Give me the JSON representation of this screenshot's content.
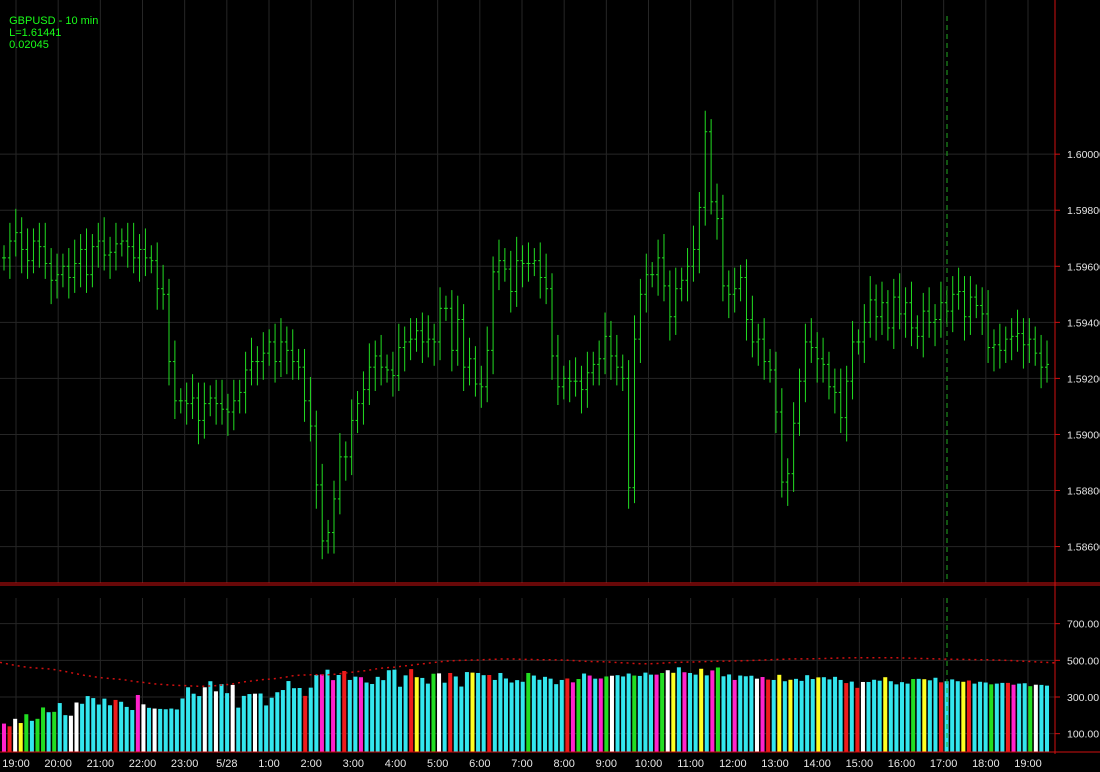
{
  "header": {
    "symbol_interval": "GBPUSD - 10 min",
    "last": "L=1.61441",
    "change": "0.02045"
  },
  "colors": {
    "background": "#000000",
    "grid": "#262626",
    "price_bars": "#22dd22",
    "axis_border": "#d01010",
    "axis_text": "#e6e6e6",
    "volume_up": "#33e6ee",
    "volume_strong": "#ffffff",
    "volume_down": "#ee1c1c",
    "volume_green": "#22dd22",
    "volume_yellow": "#ffff22",
    "volume_magenta": "#ff22cc",
    "volume_average": "#d01010",
    "cursor": "#22aa22"
  },
  "chart_data": [
    {
      "type": "ohlc",
      "title": "GBPUSD - 10 min",
      "y_axis_position": "right",
      "ylim": [
        1.5847,
        1.6055
      ],
      "yticks": [
        "1.60000",
        "1.59800",
        "1.59600",
        "1.59400",
        "1.59200",
        "1.59000",
        "1.58800",
        "1.58600"
      ],
      "ytick_values": [
        1.6,
        1.598,
        1.596,
        1.594,
        1.592,
        1.59,
        1.588,
        1.586
      ],
      "x_session_labels": [
        "19:00",
        "20:00",
        "21:00",
        "22:00",
        "23:00",
        "5/28",
        "1:00",
        "2:00",
        "3:00",
        "4:00",
        "5:00",
        "6:00",
        "7:00",
        "8:00",
        "9:00",
        "10:00",
        "11:00",
        "12:00",
        "13:00",
        "14:00",
        "15:00",
        "16:00",
        "17:00",
        "18:00",
        "19:00"
      ],
      "grid": true,
      "bar_interval": "10 min",
      "closes": [
        1.5963,
        1.5969,
        1.5972,
        1.5966,
        1.5962,
        1.5969,
        1.5967,
        1.5961,
        1.5955,
        1.5957,
        1.596,
        1.5956,
        1.5961,
        1.5966,
        1.5957,
        1.5967,
        1.5969,
        1.5964,
        1.5965,
        1.5968,
        1.5969,
        1.5967,
        1.5963,
        1.5966,
        1.5963,
        1.5962,
        1.5952,
        1.595,
        1.5926,
        1.5912,
        1.5912,
        1.5911,
        1.5913,
        1.5905,
        1.5911,
        1.5913,
        1.5911,
        1.5909,
        1.5908,
        1.5912,
        1.5915,
        1.5923,
        1.5926,
        1.5926,
        1.5929,
        1.5933,
        1.5926,
        1.5933,
        1.593,
        1.5926,
        1.5924,
        1.5912,
        1.5903,
        1.5882,
        1.5862,
        1.5865,
        1.5877,
        1.5892,
        1.5892,
        1.5905,
        1.5911,
        1.5916,
        1.5924,
        1.5928,
        1.5924,
        1.5923,
        1.5921,
        1.5931,
        1.5933,
        1.5934,
        1.5937,
        1.5933,
        1.5934,
        1.5933,
        1.5945,
        1.5945,
        1.593,
        1.5941,
        1.5924,
        1.5927,
        1.5918,
        1.5917,
        1.593,
        1.5958,
        1.5962,
        1.5959,
        1.5951,
        1.5962,
        1.5961,
        1.5961,
        1.5962,
        1.5956,
        1.5952,
        1.5928,
        1.5917,
        1.592,
        1.5919,
        1.5919,
        1.5916,
        1.5922,
        1.5925,
        1.5927,
        1.5935,
        1.5928,
        1.5924,
        1.592,
        1.5881,
        1.5934,
        1.595,
        1.5957,
        1.5957,
        1.5963,
        1.5953,
        1.5942,
        1.5952,
        1.5955,
        1.596,
        1.5966,
        1.5981,
        1.6008,
        1.5983,
        1.5977,
        1.5953,
        1.595,
        1.5952,
        1.5956,
        1.5941,
        1.5933,
        1.5934,
        1.5926,
        1.5923,
        1.5908,
        1.5883,
        1.5886,
        1.5904,
        1.5919,
        1.5933,
        1.5931,
        1.5927,
        1.5925,
        1.5917,
        1.5915,
        1.5906,
        1.5919,
        1.5933,
        1.5933,
        1.594,
        1.5948,
        1.5942,
        1.5947,
        1.5938,
        1.5949,
        1.5943,
        1.5947,
        1.5938,
        1.5935,
        1.5944,
        1.594,
        1.5941,
        1.5947,
        1.5944,
        1.595,
        1.5951,
        1.5942,
        1.5949,
        1.5946,
        1.5943,
        1.5931,
        1.5932,
        1.593,
        1.5934,
        1.5935,
        1.5936,
        1.5932,
        1.5934,
        1.5929,
        1.5924,
        1.5925
      ]
    },
    {
      "type": "bar",
      "title": "Volume",
      "y_axis_position": "right",
      "ylim": [
        0,
        840
      ],
      "yticks": [
        "700.00",
        "500.00",
        "300.00",
        "100.00"
      ],
      "ytick_values": [
        700,
        500,
        300,
        100
      ],
      "grid": true,
      "average_line": "dotted, red",
      "values": [
        155,
        140,
        181,
        158,
        206,
        170,
        181,
        243,
        217,
        219,
        267,
        201,
        198,
        270,
        263,
        305,
        294,
        259,
        291,
        255,
        284,
        274,
        246,
        229,
        311,
        260,
        241,
        237,
        235,
        233,
        237,
        232,
        292,
        353,
        318,
        305,
        353,
        386,
        331,
        370,
        321,
        366,
        242,
        306,
        316,
        318,
        319,
        254,
        296,
        326,
        338,
        387,
        348,
        349,
        306,
        351,
        420,
        423,
        449,
        392,
        420,
        442,
        393,
        411,
        408,
        379,
        371,
        410,
        392,
        446,
        449,
        356,
        418,
        452,
        408,
        404,
        373,
        427,
        429,
        378,
        431,
        412,
        357,
        436,
        433,
        431,
        419,
        420,
        393,
        431,
        401,
        379,
        392,
        383,
        431,
        417,
        394,
        410,
        400,
        370,
        393,
        401,
        380,
        398,
        428,
        417,
        400,
        401,
        412,
        416,
        419,
        412,
        428,
        417,
        415,
        433,
        422,
        422,
        431,
        446,
        432,
        462,
        435,
        431,
        422,
        454,
        418,
        445,
        461,
        413,
        423,
        393,
        417,
        413,
        416,
        400,
        409,
        395,
        393,
        421,
        386,
        394,
        399,
        388,
        419,
        398,
        407,
        408,
        396,
        410,
        393,
        376,
        384,
        350,
        382,
        382,
        394,
        389,
        408,
        386,
        369,
        381,
        373,
        398,
        399,
        397,
        391,
        405,
        380,
        386,
        396,
        386,
        383,
        390,
        373,
        383,
        379,
        369,
        373,
        377,
        377,
        367,
        373,
        375,
        359,
        367,
        366,
        362
      ],
      "average": [
        489,
        483,
        476,
        471,
        466,
        462,
        459,
        457,
        455,
        452,
        448,
        442,
        437,
        430,
        424,
        418,
        414,
        409,
        405,
        402,
        400,
        397,
        394,
        389,
        384,
        381,
        377,
        373,
        370,
        368,
        366,
        364,
        363,
        362,
        360,
        359,
        359,
        360,
        361,
        364,
        367,
        370,
        376,
        381,
        385,
        389,
        393,
        396,
        398,
        401,
        406,
        410,
        416,
        419,
        420,
        421,
        421,
        420,
        421,
        423,
        426,
        430,
        434,
        437,
        441,
        444,
        450,
        455,
        458,
        461,
        463,
        467,
        470,
        474,
        478,
        481,
        485,
        489,
        492,
        496,
        497,
        499,
        500,
        502,
        502,
        502,
        504,
        505,
        506,
        507,
        507,
        507,
        506,
        505,
        505,
        504,
        503,
        503,
        503,
        502,
        502,
        500,
        498,
        496,
        494,
        493,
        493,
        492,
        491,
        489,
        487,
        486,
        484,
        482,
        481,
        481,
        482,
        484,
        486,
        488,
        489,
        490,
        491,
        491,
        492,
        493,
        494,
        495,
        496,
        496,
        497,
        497,
        498,
        499,
        500,
        501,
        503,
        504,
        505,
        506,
        507,
        508,
        508,
        508,
        509,
        509,
        510,
        511,
        512,
        513,
        513,
        514,
        514,
        514,
        514,
        514,
        514,
        514,
        514,
        514,
        513,
        512,
        511,
        510,
        510,
        509,
        508,
        507,
        506,
        506,
        505,
        505,
        504,
        504,
        503,
        503,
        502,
        501,
        500,
        499,
        497,
        496,
        495,
        493,
        491,
        490,
        488,
        486
      ]
    }
  ]
}
